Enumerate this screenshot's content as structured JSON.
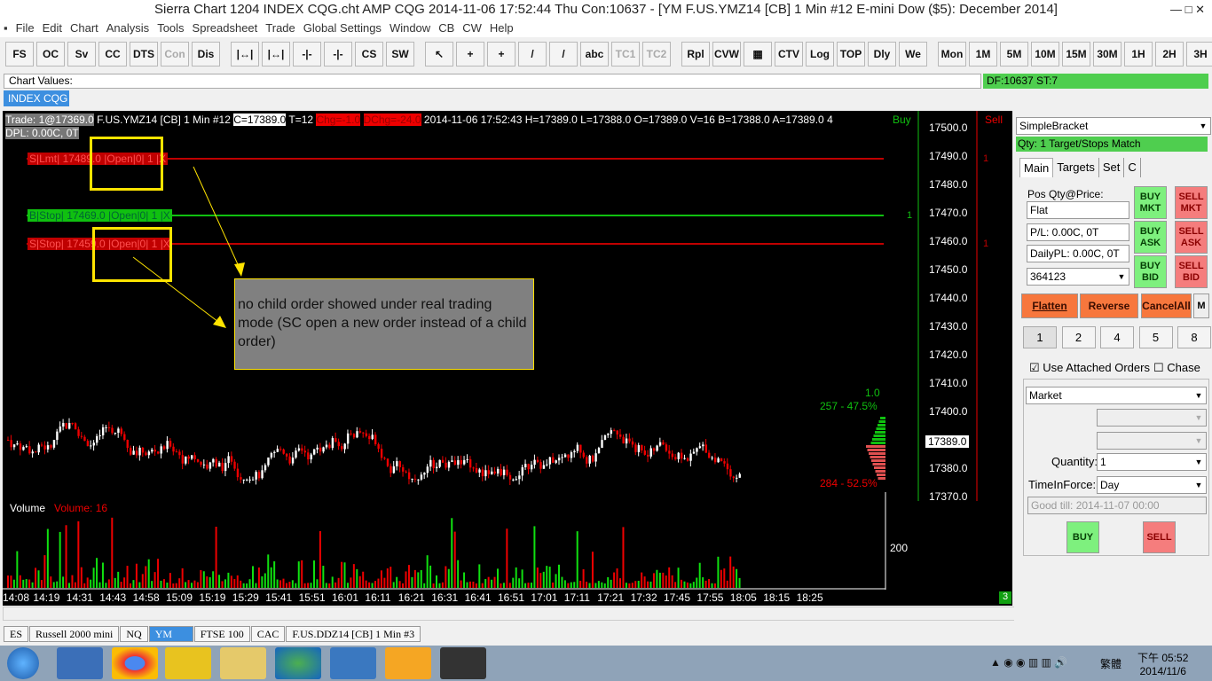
{
  "title": "Sierra Chart 1204 INDEX CQG.cht  AMP CQG 2014-11-06  17:52:44 Thu  Con:10637 - [YM  F.US.YMZ14 [CB]  1 Min  #12  E-mini Dow ($5): December 2014]",
  "menu": [
    "File",
    "Edit",
    "Chart",
    "Analysis",
    "Tools",
    "Spreadsheet",
    "Trade",
    "Global Settings",
    "Window",
    "CB",
    "CW",
    "Help"
  ],
  "toolbar": [
    "FS",
    "OC",
    "Sv",
    "CC",
    "DTS",
    "Con",
    "Dis",
    "|↔|",
    "|↔|",
    "-|-",
    "-|-",
    "CS",
    "SW",
    "↖",
    "+",
    "+",
    "/",
    "/",
    "abc",
    "TC1",
    "TC2",
    "Rpl",
    "CVW",
    "▦",
    "CTV",
    "Log",
    "TOP",
    "Dly",
    "We",
    "Mon",
    "1M",
    "5M",
    "10M",
    "15M",
    "30M",
    "1H",
    "2H",
    "3H"
  ],
  "toolbar_disabled": [
    5,
    19,
    20
  ],
  "chart_values_label": "Chart Values:",
  "df_status": "DF:10637  ST:7",
  "chart_tab": "INDEX CQG",
  "info": {
    "trade": "Trade: 1@17369.0",
    "symbol": "F.US.YMZ14 [CB]  1 Min  #12",
    "c": "C=17389.0",
    "t": "T=12",
    "chg": "Chg=-1.0",
    "dchg": "DChg=-24.0",
    "rest": "2014-11-06 17:52:43 H=17389.0 L=17388.0 O=17389.0 V=16 B=17388.0 A=17389.0 4",
    "dpl": "DPL: 0.00C, 0T"
  },
  "orders": [
    {
      "text": "S|Lmt| 17489.0 |Open|0| 1 |X",
      "price": 17489,
      "color": "#c00000",
      "count": "1"
    },
    {
      "text": "B|Stop| 17469.0 |Open|0| 1 |X",
      "price": 17469,
      "color": "#10c010",
      "count": "1"
    },
    {
      "text": "S|Stop| 17459.0 |Open|0| 1 |X",
      "price": 17459,
      "color": "#c00000",
      "count": "1"
    }
  ],
  "annotation": "no  child order showed under real trading mode (SC open a new order instead of a child order)",
  "buy_label": "Buy",
  "sell_label": "Sell",
  "price_axis": [
    "17500.0",
    "17490.0",
    "17480.0",
    "17470.0",
    "17460.0",
    "17450.0",
    "17440.0",
    "17430.0",
    "17420.0",
    "17410.0",
    "17400.0",
    "17390.0",
    "17380.0",
    "17370.0"
  ],
  "last_price": "17389.0",
  "ratio": {
    "top": "1.0",
    "buy": "257 - 47.5%",
    "sell": "284 - 52.5%"
  },
  "volume": {
    "label": "Volume",
    "value": "Volume: 16",
    "axis": "200"
  },
  "time_axis": [
    "14:08",
    "14:19",
    "14:31",
    "14:43",
    "14:58",
    "15:09",
    "15:19",
    "15:29",
    "15:41",
    "15:51",
    "16:01",
    "16:11",
    "16:21",
    "16:31",
    "16:41",
    "16:51",
    "17:01",
    "17:11",
    "17:21",
    "17:32",
    "17:45",
    "17:55",
    "18:05",
    "18:15",
    "18:25"
  ],
  "corner_badge": "3",
  "panel": {
    "strategy": "SimpleBracket",
    "qty_status": "Qty: 1 Target/Stops Match",
    "tabs": [
      "Main",
      "Targets",
      "Set",
      "C"
    ],
    "pos_label": "Pos Qty@Price:",
    "pos": "Flat",
    "pl": "P/L: 0.00C, 0T",
    "daily": "DailyPL: 0.00C, 0T",
    "account": "364123",
    "buy_mkt": "BUY MKT",
    "sell_mkt": "SELL MKT",
    "buy_ask": "BUY ASK",
    "sell_ask": "SELL ASK",
    "buy_bid": "BUY BID",
    "sell_bid": "SELL BID",
    "flatten": "Flatten",
    "reverse": "Reverse",
    "cancel_all": "CancelAll",
    "m": "M",
    "qty_buttons": [
      "1",
      "2",
      "4",
      "5",
      "8"
    ],
    "use_attached": "Use Attached Orders",
    "chase": "Chase",
    "order_type": "Market",
    "quantity_label": "Quantity:",
    "quantity": "1",
    "tif_label": "TimeInForce:",
    "tif": "Day",
    "good_till": "Good till: 2014-11-07 00:00",
    "buy": "BUY",
    "sell": "SELL"
  },
  "bottom_tabs": [
    "ES",
    "Russell 2000 mini",
    "NQ",
    "YM",
    "FTSE 100",
    "CAC",
    "F.US.DDZ14 [CB]  1 Min  #3"
  ],
  "active_tab": 3,
  "tray": {
    "ime": "繁體",
    "time": "下午 05:52",
    "date": "2014/11/6"
  }
}
